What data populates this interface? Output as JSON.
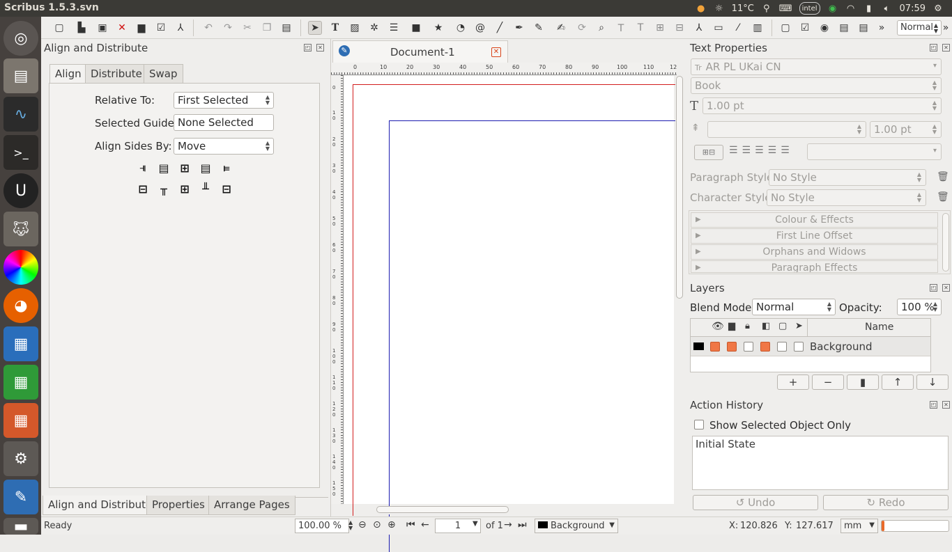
{
  "topbar": {
    "title": "Scribus 1.5.3.svn",
    "temperature": "11°C",
    "clock": "07:59",
    "intel_label": "intel"
  },
  "toolbar": {
    "icons": [
      "new-document-icon",
      "open-document-icon",
      "save-icon",
      "close-icon",
      "print-icon",
      "preflight-icon",
      "pdf-export-icon",
      "undo-icon",
      "redo-icon",
      "cut-icon",
      "copy-icon",
      "paste-icon",
      "select-icon",
      "text-frame-icon",
      "image-frame-icon",
      "render-frame-icon",
      "table-icon",
      "shape-icon",
      "polygon-icon",
      "arc-icon",
      "spiral-icon",
      "line-icon",
      "bezier-icon",
      "freehand-icon",
      "calligraphic-icon",
      "rotate-icon",
      "zoom-icon",
      "edit-text-icon",
      "edit-text-story-icon",
      "link-frames-icon",
      "unlink-frames-icon",
      "measure-icon",
      "copy-properties-icon",
      "eyedropper-icon",
      "barcode-icon",
      "pdf-push-button-icon",
      "pdf-checkbox-icon",
      "pdf-radio-icon",
      "pdf-text-field-icon",
      "pdf-combo-icon",
      "more-icon"
    ],
    "mode_select": "Normal"
  },
  "align_panel": {
    "title": "Align and Distribute",
    "tabs": [
      "Align",
      "Distribute",
      "Swap"
    ],
    "relative_to_label": "Relative To:",
    "relative_to_value": "First Selected",
    "selected_guide_label": "Selected Guide:",
    "selected_guide_value": "None Selected",
    "align_sides_label": "Align Sides By:",
    "align_sides_value": "Move"
  },
  "bottom_tabs": [
    "Align and Distribute",
    "Properties",
    "Arrange Pages"
  ],
  "document": {
    "tab_title": "Document-1",
    "ruler_labels": [
      "0",
      "10",
      "20",
      "30",
      "40",
      "50",
      "60",
      "70",
      "80",
      "90",
      "100",
      "110",
      "12"
    ],
    "vruler_labels": [
      "0",
      "10",
      "20",
      "30",
      "40",
      "50",
      "60",
      "70",
      "80",
      "90",
      "100",
      "110",
      "120",
      "130",
      "140",
      "150"
    ]
  },
  "text_properties": {
    "title": "Text Properties",
    "font": "AR PL UKai CN",
    "style": "Book",
    "size": "1.00 pt",
    "line_spacing": "1.00 pt",
    "paragraph_style_label": "Paragraph Style:",
    "paragraph_style_value": "No Style",
    "character_style_label": "Character Style:",
    "character_style_value": "No Style",
    "sections": [
      "Colour & Effects",
      "First Line Offset",
      "Orphans and Widows",
      "Paragraph Effects"
    ]
  },
  "layers": {
    "title": "Layers",
    "blend_label": "Blend Mode:",
    "blend_value": "Normal",
    "opacity_label": "Opacity:",
    "opacity_value": "100 %",
    "name_header": "Name",
    "rows": [
      {
        "name": "Background",
        "color": "#000000"
      }
    ],
    "buttons": [
      "+",
      "−",
      "▮",
      "↑",
      "↓"
    ]
  },
  "history": {
    "title": "Action History",
    "show_selected_label": "Show Selected Object Only",
    "entries": [
      "Initial State"
    ],
    "undo_label": "Undo",
    "redo_label": "Redo"
  },
  "status": {
    "ready": "Ready",
    "zoom": "100.00 %",
    "page": "1",
    "of_pages": "of 1",
    "layer": "Background",
    "x_label": "X:",
    "x_value": "120.826",
    "y_label": "Y:",
    "y_value": "127.617",
    "unit": "mm"
  }
}
